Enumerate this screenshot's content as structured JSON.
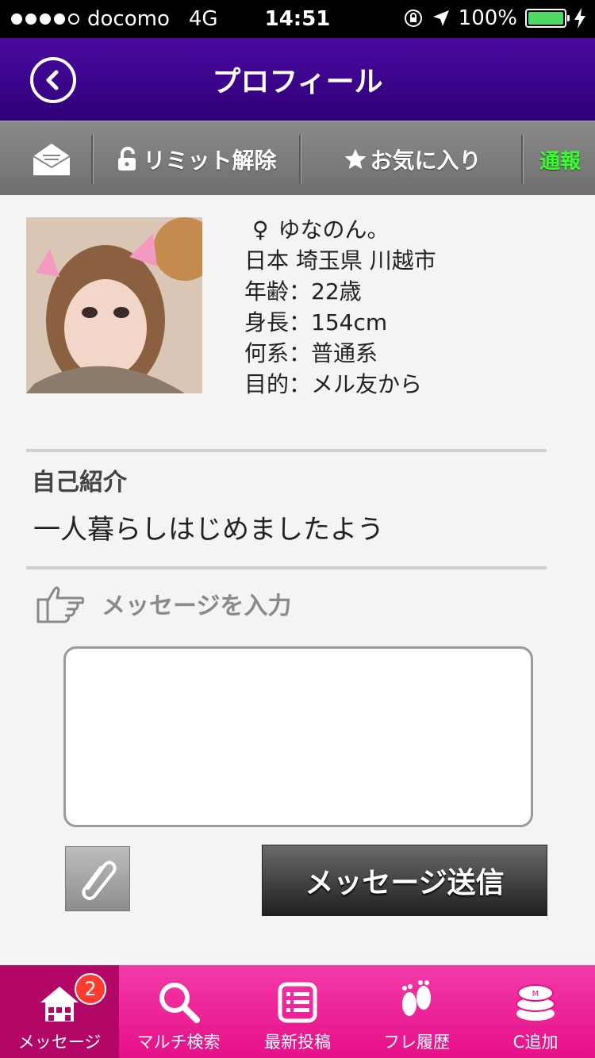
{
  "statusbar": {
    "carrier": "docomo",
    "network": "4G",
    "time": "14:51",
    "battery": "100%",
    "signal_bars": 4
  },
  "header": {
    "title": "プロフィール",
    "back_icon": "back-arrow-circle-icon"
  },
  "actions": {
    "mail_icon": "envelope-open-icon",
    "limit_label": "リミット解除",
    "favorite_label": "お気に入り",
    "report_label": "通報"
  },
  "profile": {
    "gender_symbol": "♀",
    "name": "ゆなのん。",
    "location": "日本 埼玉県 川越市",
    "age": "年齢：22歳",
    "height": "身長：154cm",
    "type": "何系：普通系",
    "purpose": "目的：メル友から"
  },
  "intro": {
    "heading": "自己紹介",
    "text": "一人暮らしはじめましたよう"
  },
  "message": {
    "heading": "メッセージを入力",
    "value": "",
    "send_label": "メッセージ送信"
  },
  "tabbar": {
    "items": [
      {
        "label": "メッセージ",
        "icon": "house-icon",
        "badge": "2"
      },
      {
        "label": "マルチ検索",
        "icon": "magnifier-icon"
      },
      {
        "label": "最新投稿",
        "icon": "list-icon"
      },
      {
        "label": "フレ履歴",
        "icon": "footprints-icon"
      },
      {
        "label": "C追加",
        "icon": "coins-icon"
      }
    ]
  },
  "colors": {
    "header": "#3a038c",
    "tabbar": "#ea1991",
    "tab_active": "#b30767",
    "report": "#37ff2e",
    "battery": "#4cd964"
  }
}
